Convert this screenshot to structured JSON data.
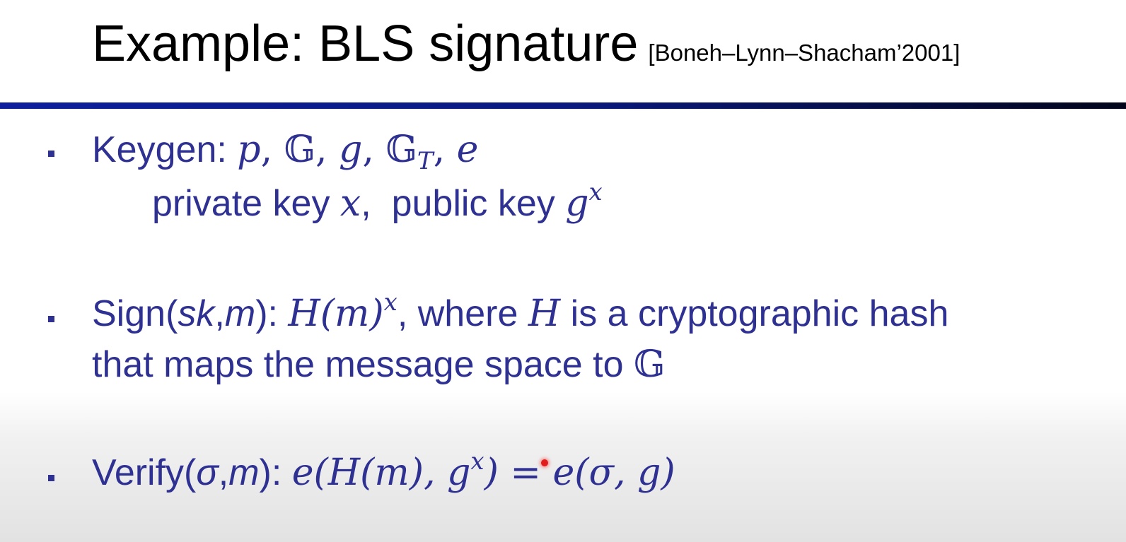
{
  "slide": {
    "title": "Example: BLS signature",
    "title_ref": "[Boneh–Lynn–Shacham’2001]",
    "keygen": {
      "label": "Keygen: ",
      "p": "p",
      "G": "𝔾",
      "g": "g",
      "GT_base": "𝔾",
      "GT_sub": "T",
      "e": "e",
      "sep": ", ",
      "private_label": "private key ",
      "x": "x",
      "comma_gap": ",  ",
      "public_label": "public key ",
      "public_base": "g",
      "public_exp": "x"
    },
    "sign": {
      "label": "Sign(",
      "sk": "sk",
      "comma": ",",
      "m": "m",
      "label_end": "): ",
      "H": "H",
      "paren_m": "(m)",
      "exp": "x",
      "where": ", where ",
      "H2": "H",
      "rest": " is a cryptographic hash",
      "line2": "that maps the message space to ",
      "G": "𝔾"
    },
    "verify": {
      "label": "Verify(",
      "sigma": "σ",
      "comma": ",",
      "m": "m",
      "label_end": "): ",
      "lhs_open": "e(H(m), g",
      "lhs_exp": "x",
      "lhs_close": ")",
      "eq": " = ",
      "rhs": "e(σ, g)"
    }
  }
}
